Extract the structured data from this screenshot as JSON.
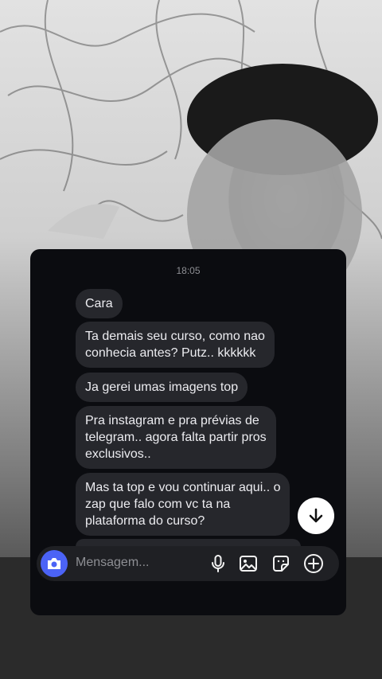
{
  "chat": {
    "timestamp": "18:05",
    "messages": [
      {
        "text": "Cara"
      },
      {
        "text": "Ta demais seu curso, como nao\nconhecia antes? Putz.. kkkkkk"
      },
      {
        "text": "Ja gerei umas imagens top"
      },
      {
        "text": "Pra instagram e pra prévias de\ntelegram.. agora falta partir pros\nexclusivos.."
      },
      {
        "text": "Mas ta top e vou continuar aqui.. o\nzap que falo com vc ta na\nplataforma do curso?"
      }
    ]
  },
  "composer": {
    "placeholder": "Mensagem...",
    "icons": [
      "camera-icon",
      "microphone-icon",
      "gallery-icon",
      "sticker-icon",
      "add-icon"
    ]
  },
  "scroll_button": {
    "icon": "arrow-down-icon"
  },
  "colors": {
    "accent": "#4b63f6",
    "bubble": "#26272c",
    "panel": "#0b0c10"
  }
}
